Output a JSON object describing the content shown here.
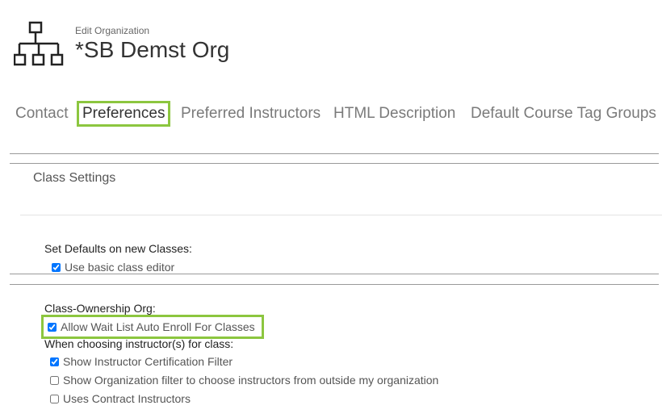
{
  "header": {
    "subtitle": "Edit Organization",
    "title": "*SB Demst Org",
    "icon": "org-chart-icon"
  },
  "tabs": [
    {
      "label": "Contact",
      "active": false
    },
    {
      "label": "Preferences",
      "active": true
    },
    {
      "label": "Preferred Instructors",
      "active": false
    },
    {
      "label": "HTML Description",
      "active": false
    },
    {
      "label": "Default Course Tag Groups",
      "active": false
    }
  ],
  "section": {
    "title": "Class Settings"
  },
  "defaults_group": {
    "label": "Set Defaults on new Classes:",
    "options": [
      {
        "label": "Use basic class editor",
        "checked": true
      }
    ]
  },
  "ownership_group": {
    "label": "Class-Ownership Org:",
    "options": [
      {
        "label": "Allow Wait List Auto Enroll For Classes",
        "checked": true
      }
    ]
  },
  "instructor_group": {
    "label": "When choosing instructor(s) for class:",
    "options": [
      {
        "label": "Show Instructor Certification Filter",
        "checked": true
      },
      {
        "label": "Show Organization filter to choose instructors from outside my organization",
        "checked": false
      },
      {
        "label": "Uses Contract Instructors",
        "checked": false
      }
    ]
  },
  "colors": {
    "highlight": "#8cc63f",
    "tab_inactive": "#7a7a7a",
    "text": "#333333"
  }
}
